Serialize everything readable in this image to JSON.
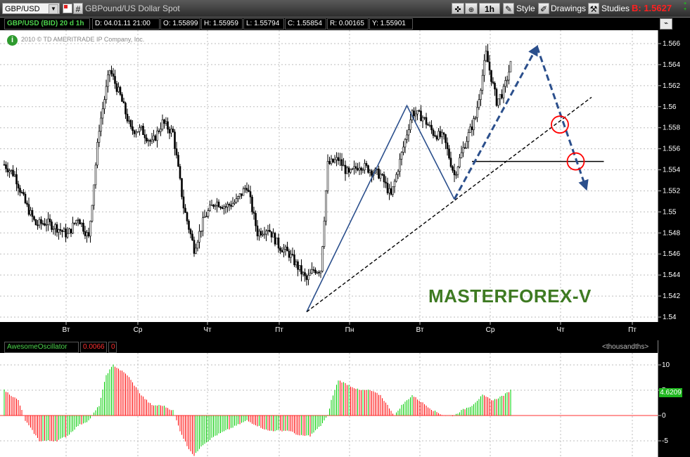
{
  "toolbar": {
    "symbol": "GBP/USD",
    "hash": "#",
    "description": "GBPound/US Dollar Spot",
    "timeframe": "1h",
    "style_label": "Style",
    "drawings_label": "Drawings",
    "studies_label": "Studies",
    "bid": "B: 1.5627"
  },
  "info_bar": {
    "title": "GBP/USD (BID) 20 d 1h",
    "date": "D: 04.01.11 21:00",
    "open": "O: 1.55899",
    "high": "H: 1.55959",
    "low": "L: 1.55794",
    "close": "C: 1.55854",
    "range": "R: 0.00165",
    "y": "Y: 1.55901"
  },
  "copyright": "2010 © TD AMERITRADE IP Company, Inc.",
  "watermark": "MASTERFOREX-V",
  "oscillator": {
    "name": "AwesomeOscillator",
    "value": "0.0066",
    "value2": "0",
    "units": "<thousandths>",
    "current": "4.6209"
  },
  "colors": {
    "up_bar": "#00cc00",
    "down_bar": "#ff0000",
    "pattern_line": "#2b4f8c",
    "trend_line": "#000000",
    "circle": "#ff0000",
    "watermark": "#3e7a22",
    "bid": "#ff2020"
  },
  "chart_data": [
    {
      "type": "candlestick",
      "title": "GBP/USD (BID) 20 d 1h",
      "ylim": [
        1.54,
        1.567
      ],
      "y_ticks": [
        1.54,
        1.542,
        1.544,
        1.546,
        1.548,
        1.55,
        1.552,
        1.554,
        1.556,
        1.558,
        1.56,
        1.562,
        1.564,
        1.566
      ],
      "y_tick_labels": [
        "1.54",
        "1.542",
        "1.544",
        "1.546",
        "1.548",
        "1.55",
        "1.552",
        "1.554",
        "1.556",
        "1.558",
        "1.56",
        "1.562",
        "1.564",
        "1.566"
      ],
      "x_tick_labels": [
        "Вт",
        "Ср",
        "Чт",
        "Пт",
        "Пн",
        "Вт",
        "Ср",
        "Чт",
        "Пт"
      ],
      "grid": true,
      "close_path": [
        [
          0,
          1.5545
        ],
        [
          6,
          1.5535
        ],
        [
          12,
          1.5508
        ],
        [
          18,
          1.5488
        ],
        [
          24,
          1.549
        ],
        [
          30,
          1.5485
        ],
        [
          36,
          1.5478
        ],
        [
          42,
          1.5495
        ],
        [
          48,
          1.5475
        ],
        [
          54,
          1.558
        ],
        [
          60,
          1.5635
        ],
        [
          66,
          1.561
        ],
        [
          72,
          1.5578
        ],
        [
          78,
          1.5578
        ],
        [
          84,
          1.5565
        ],
        [
          90,
          1.5585
        ],
        [
          96,
          1.5575
        ],
        [
          102,
          1.5505
        ],
        [
          108,
          1.5465
        ],
        [
          114,
          1.5495
        ],
        [
          120,
          1.551
        ],
        [
          126,
          1.5505
        ],
        [
          132,
          1.551
        ],
        [
          138,
          1.5525
        ],
        [
          144,
          1.548
        ],
        [
          150,
          1.5485
        ],
        [
          156,
          1.5468
        ],
        [
          162,
          1.546
        ],
        [
          168,
          1.5445
        ],
        [
          172,
          1.5435
        ],
        [
          176,
          1.5445
        ],
        [
          180,
          1.5445
        ],
        [
          184,
          1.5545
        ],
        [
          190,
          1.555
        ],
        [
          196,
          1.5535
        ],
        [
          202,
          1.5545
        ],
        [
          208,
          1.554
        ],
        [
          214,
          1.5535
        ],
        [
          220,
          1.5515
        ],
        [
          226,
          1.5555
        ],
        [
          232,
          1.5595
        ],
        [
          238,
          1.559
        ],
        [
          244,
          1.5575
        ],
        [
          250,
          1.557
        ],
        [
          256,
          1.5535
        ],
        [
          262,
          1.5565
        ],
        [
          268,
          1.559
        ],
        [
          274,
          1.565
        ],
        [
          280,
          1.5605
        ],
        [
          284,
          1.5615
        ],
        [
          288,
          1.564
        ]
      ],
      "annotations": {
        "pattern_points": [
          [
            172,
            1.5405
          ],
          [
            229,
            1.5601
          ],
          [
            256,
            1.5512
          ],
          [
            303,
            1.5657
          ],
          [
            331,
            1.5522
          ]
        ],
        "dashed_segments": [
          [
            [
              256,
              1.5512
            ],
            [
              303,
              1.5657
            ]
          ],
          [
            [
              303,
              1.5657
            ],
            [
              331,
              1.5522
            ]
          ]
        ],
        "trendline": [
          [
            172,
            1.5405
          ],
          [
            334,
            1.5609
          ]
        ],
        "horizontal_level": {
          "y": 1.5548,
          "x": [
            266,
            341
          ]
        },
        "circles": [
          [
            316,
            1.5583
          ],
          [
            325,
            1.5548
          ]
        ]
      }
    },
    {
      "type": "histogram",
      "title": "AwesomeOscillator",
      "units": "<thousandths>",
      "ylim": [
        -7,
        12
      ],
      "y_ticks": [
        -5,
        0,
        5,
        10
      ],
      "y_tick_labels": [
        "-5",
        "0",
        "5",
        "10"
      ],
      "last_value": 4.6209,
      "values_path": [
        [
          0,
          5
        ],
        [
          4,
          4
        ],
        [
          8,
          3
        ],
        [
          12,
          -1
        ],
        [
          16,
          -3
        ],
        [
          20,
          -5
        ],
        [
          24,
          -5
        ],
        [
          30,
          -5
        ],
        [
          36,
          -4
        ],
        [
          42,
          -2
        ],
        [
          48,
          -1
        ],
        [
          54,
          2
        ],
        [
          58,
          8
        ],
        [
          62,
          10
        ],
        [
          66,
          9
        ],
        [
          70,
          8
        ],
        [
          74,
          6
        ],
        [
          78,
          4
        ],
        [
          84,
          2
        ],
        [
          90,
          2
        ],
        [
          96,
          1
        ],
        [
          100,
          -3
        ],
        [
          104,
          -6
        ],
        [
          108,
          -8
        ],
        [
          112,
          -6
        ],
        [
          116,
          -5
        ],
        [
          120,
          -4
        ],
        [
          126,
          -3
        ],
        [
          132,
          -2
        ],
        [
          138,
          -1
        ],
        [
          144,
          -2
        ],
        [
          150,
          -3
        ],
        [
          156,
          -3
        ],
        [
          162,
          -3
        ],
        [
          168,
          -4
        ],
        [
          174,
          -4
        ],
        [
          180,
          -2
        ],
        [
          184,
          0
        ],
        [
          186,
          3
        ],
        [
          190,
          7
        ],
        [
          196,
          6
        ],
        [
          202,
          5
        ],
        [
          208,
          5
        ],
        [
          214,
          4
        ],
        [
          218,
          2
        ],
        [
          222,
          0
        ],
        [
          226,
          2
        ],
        [
          232,
          4
        ],
        [
          236,
          3
        ],
        [
          240,
          2
        ],
        [
          244,
          1
        ],
        [
          250,
          0
        ],
        [
          256,
          0
        ],
        [
          260,
          1
        ],
        [
          266,
          2
        ],
        [
          272,
          4
        ],
        [
          278,
          3
        ],
        [
          284,
          4
        ],
        [
          288,
          5
        ]
      ]
    }
  ]
}
